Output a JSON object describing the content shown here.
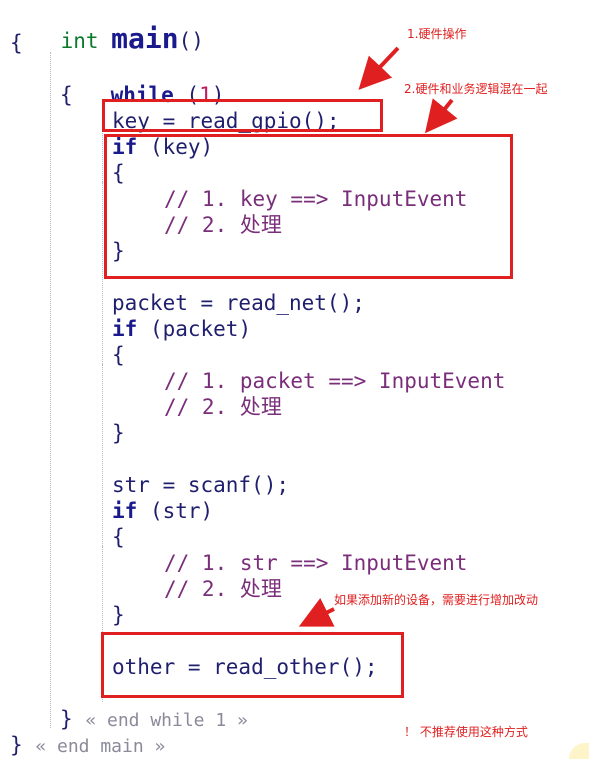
{
  "code": {
    "l1_type": "int",
    "l1_name": "main",
    "l1_parens": "()",
    "l2": "{",
    "l3_kw": "while",
    "l3_open": "(",
    "l3_num": "1",
    "l3_close": ")",
    "l4": "{",
    "l5": "key = read_gpio();",
    "l6_kw": "if",
    "l6_rest": " (key)",
    "l7": "{",
    "l8": "// 1. key ==> InputEvent",
    "l9": "// 2. 处理",
    "l10": "}",
    "l11": "packet = read_net();",
    "l12_kw": "if",
    "l12_rest": " (packet)",
    "l13": "{",
    "l14": "// 1. packet ==> InputEvent",
    "l15": "// 2. 处理",
    "l16": "}",
    "l17": "str = scanf();",
    "l18_kw": "if",
    "l18_rest": " (str)",
    "l19": "{",
    "l20": "// 1. str ==> InputEvent",
    "l21": "// 2. 处理",
    "l22": "}",
    "l23": "other = read_other();",
    "l24_brace": "}",
    "l24_end": "« end while 1 »",
    "l25_brace": "}",
    "l25_end": "« end main »"
  },
  "annotations": {
    "note1": "1.硬件操作",
    "note2": "2.硬件和业务逻辑混在一起",
    "note3": "如果添加新的设备，需要进行增加改动",
    "note4": "！ 不推荐使用这种方式"
  },
  "colors": {
    "annotation_red": "#e02020",
    "keyword_green": "#0b7a2b",
    "identifier_navy": "#1a1a8c",
    "comment_purple": "#7a2e7a",
    "number_pink": "#c2185b"
  }
}
